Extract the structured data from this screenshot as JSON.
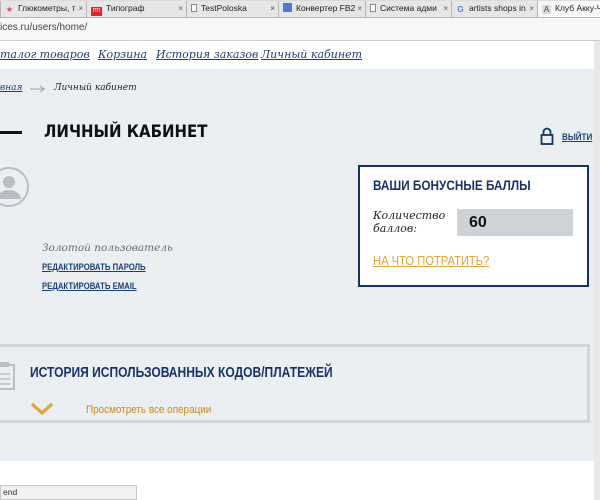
{
  "browser": {
    "tabs": [
      {
        "title": "Глюкометры, т",
        "favicon": "★",
        "favicon_color": "#e0399b",
        "active": false
      },
      {
        "title": "Типограф",
        "favicon": "ПП",
        "favicon_color": "#d9262b",
        "active": false
      },
      {
        "title": "TestPoloska",
        "favicon": "",
        "favicon_color": "#888888",
        "active": false
      },
      {
        "title": "Конвертер FB2",
        "favicon": "",
        "favicon_color": "#4a7bd1",
        "active": false
      },
      {
        "title": "Система адми",
        "favicon": "",
        "favicon_color": "#888888",
        "active": false
      },
      {
        "title": "artists shops in",
        "favicon": "G",
        "favicon_color": "#4285f4",
        "active": false
      },
      {
        "title": "Клуб Акку-Че",
        "favicon": "A",
        "favicon_color": "#666666",
        "active": true
      }
    ],
    "close_glyph": "×",
    "url": "ices.ru/users/home/"
  },
  "nav": {
    "items": [
      "талог товаров",
      "Корзина",
      "История заказов",
      "Личный кабинет"
    ]
  },
  "breadcrumb": {
    "parent": "вная",
    "current": "Личный кабинет"
  },
  "header": {
    "title": "ЛИЧНЫЙ КАБИНЕТ",
    "logout_label": "ВЫЙТИ"
  },
  "profile": {
    "status": "Золотой пользователь",
    "edit_password": "РЕДАКТИРОВАТЬ ПАРОЛЬ",
    "edit_email": "РЕДАКТИРОВАТЬ EMAIL"
  },
  "bonus": {
    "title": "ВАШИ БОНУСНЫЕ БАЛЛЫ",
    "points_label": "Количество баллов:",
    "points_value": "60",
    "spend_link": "НА ЧТО ПОТРАТИТЬ?"
  },
  "history": {
    "title": "ИСТОРИЯ ИСПОЛЬЗОВАННЫХ КОДОВ/ПЛАТЕЖЕЙ",
    "view_all": "Просмотреть все операции"
  },
  "status_bar": {
    "text": "end"
  },
  "colors": {
    "accent_navy": "#17326a",
    "accent_orange": "#e0a43b",
    "page_bg": "#ebeff2"
  }
}
